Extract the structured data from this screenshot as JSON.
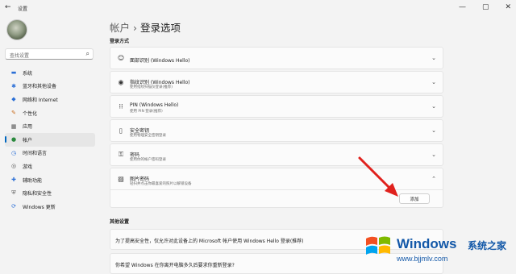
{
  "window": {
    "back_icon": "←",
    "app_title": "设置",
    "controls": [
      "—",
      "▢",
      "✕"
    ]
  },
  "search": {
    "placeholder": "查找设置",
    "icon": "⌕"
  },
  "sidebar": {
    "items": [
      {
        "label": "系统",
        "icon": "▬",
        "color": "#2b6fd6"
      },
      {
        "label": "蓝牙和其他设备",
        "icon": "✱",
        "color": "#2b6fd6"
      },
      {
        "label": "网络和 Internet",
        "icon": "◆",
        "color": "#2b6fd6"
      },
      {
        "label": "个性化",
        "icon": "✎",
        "color": "#c96b1b"
      },
      {
        "label": "应用",
        "icon": "▦",
        "color": "#555555"
      },
      {
        "label": "帐户",
        "icon": "●",
        "color": "#2b8a3e",
        "active": true
      },
      {
        "label": "时间和语言",
        "icon": "◷",
        "color": "#2b6fd6"
      },
      {
        "label": "游戏",
        "icon": "◎",
        "color": "#555555"
      },
      {
        "label": "辅助功能",
        "icon": "✚",
        "color": "#2b6fd6"
      },
      {
        "label": "隐私和安全性",
        "icon": "⛨",
        "color": "#555555"
      },
      {
        "label": "Windows 更新",
        "icon": "⟳",
        "color": "#2b6fd6"
      }
    ]
  },
  "breadcrumb": {
    "parent": "帐户",
    "separator": "›",
    "current": "登录选项"
  },
  "signin_section": {
    "title": "登录方式"
  },
  "signin_options": [
    {
      "title": "面部识别 (Windows Hello)",
      "subtitle": "",
      "icon": "☺",
      "chevron": "⌄"
    },
    {
      "title": "指纹识别 (Windows Hello)",
      "subtitle": "使用指纹扫描仪登录(推荐)",
      "icon": "◉",
      "chevron": "⌄"
    },
    {
      "title": "PIN (Windows Hello)",
      "subtitle": "使用 PIN 登录(推荐)",
      "icon": "⁞⁞",
      "chevron": "⌄"
    },
    {
      "title": "安全密钥",
      "subtitle": "使用物理安全密钥登录",
      "icon": "▯",
      "chevron": "⌄"
    },
    {
      "title": "密码",
      "subtitle": "使用你的帐户密码登录",
      "icon": "⚿",
      "chevron": "⌄"
    },
    {
      "title": "图片密码",
      "subtitle": "轻扫并点击你最喜爱的照片以解锁设备",
      "icon": "▨",
      "chevron": "⌃"
    }
  ],
  "add_button": {
    "label": "添加"
  },
  "other_section": {
    "title": "其他设置"
  },
  "other_settings": [
    {
      "text": "为了提高安全性，仅允许对此设备上的 Microsoft 帐户使用 Windows Hello 登录(推荐)"
    },
    {
      "text": "你希望 Windows 在你离开电脑多久后要求你重新登录?"
    }
  ],
  "watermark": {
    "title": "Windows",
    "cn": "系统之家",
    "url": "www.bjjmlv.com",
    "colors": [
      "#f25022",
      "#7fba00",
      "#00a4ef",
      "#ffb900"
    ]
  },
  "annotation_color": "#e0211d"
}
